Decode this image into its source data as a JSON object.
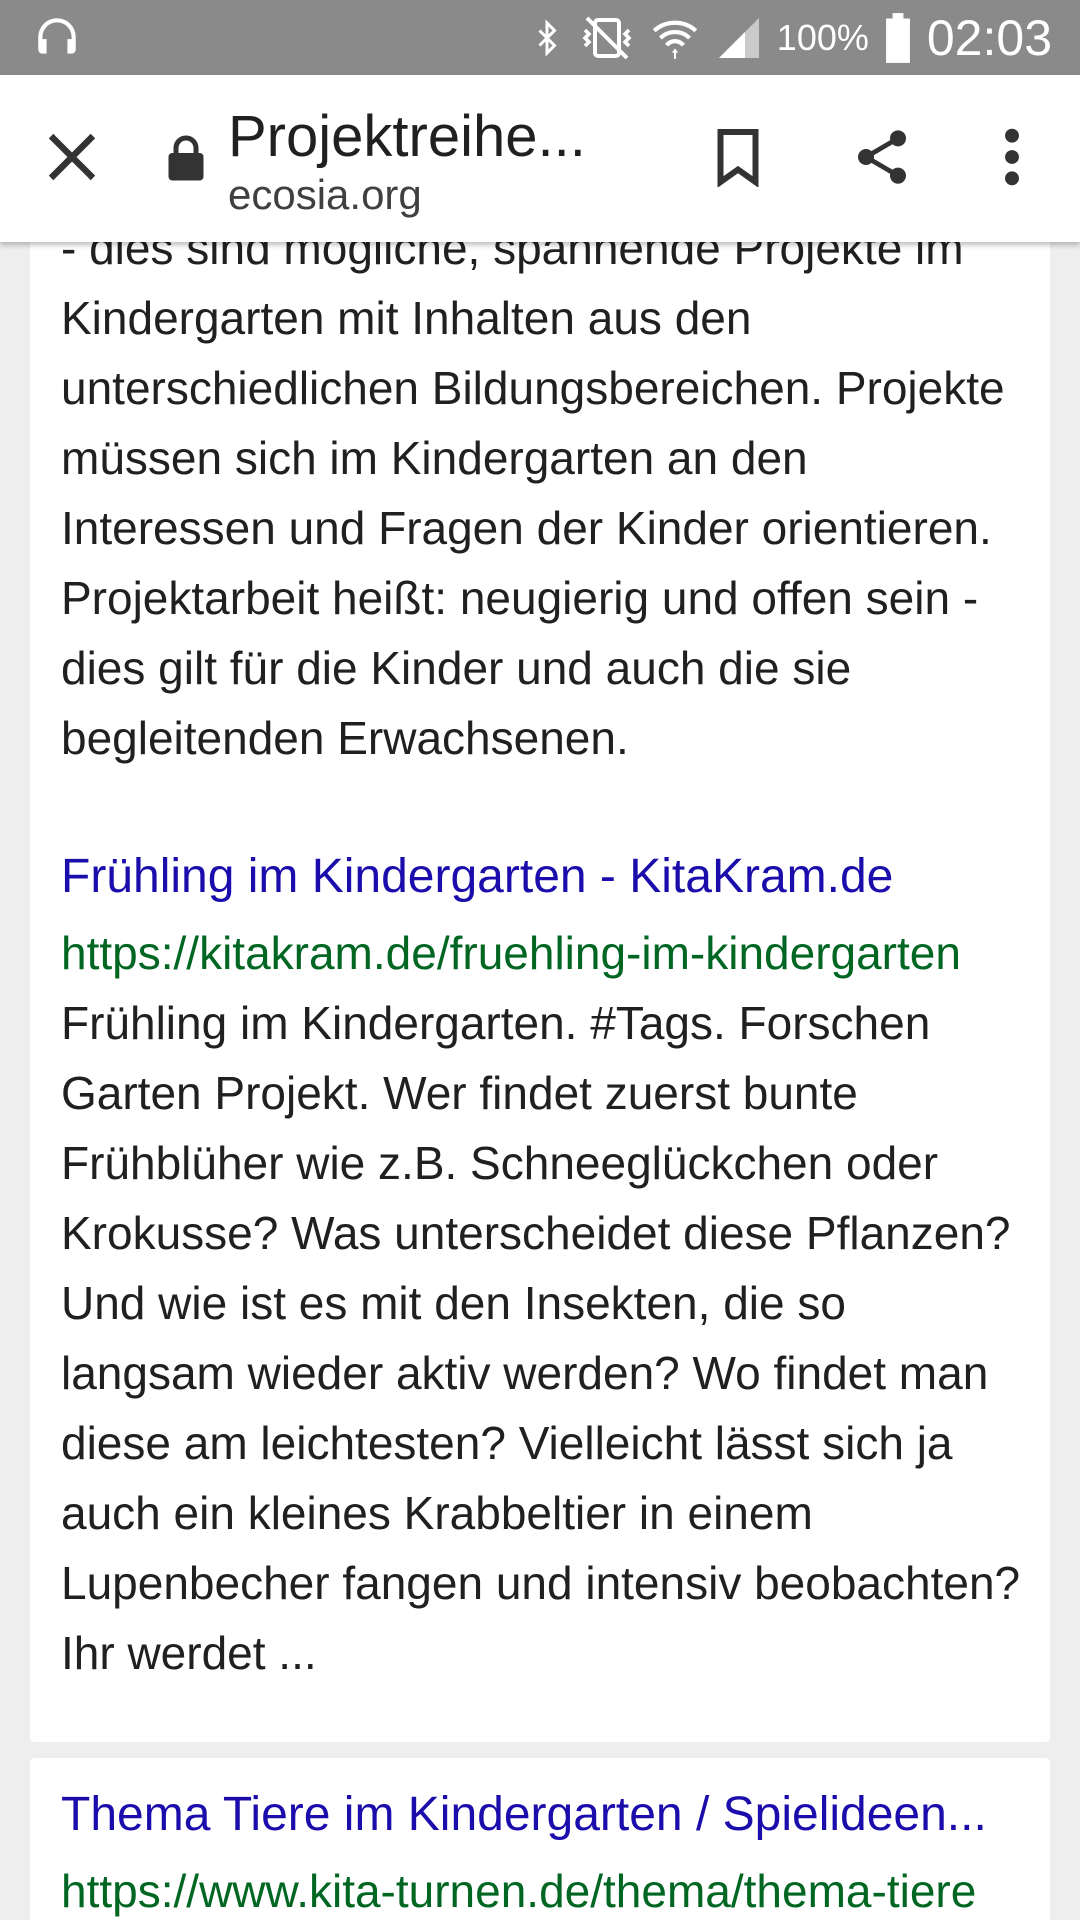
{
  "status_bar": {
    "battery_percent": "100%",
    "time": "02:03",
    "icons": [
      "headset-icon",
      "bluetooth-icon",
      "vibrate-mute-icon",
      "wifi-icon",
      "signal-icon",
      "battery-icon"
    ]
  },
  "toolbar": {
    "page_title": "Projektreihe...",
    "domain": "ecosia.org",
    "icons": [
      "close-icon",
      "lock-icon",
      "bookmark-icon",
      "share-icon",
      "more-vert-icon"
    ]
  },
  "results": [
    {
      "snippet": "- dies sind mögliche, spannende Projekte im Kindergarten mit Inhalten aus den unterschiedlichen Bildungsbereichen. Projekte müssen sich im Kindergarten an den Interessen und Fragen der Kinder orientieren. Projektarbeit heißt: neugierig und offen sein - dies gilt für die Kinder und auch die sie begleitenden Erwachsenen."
    },
    {
      "title": "Frühling im Kindergarten - KitaKram.de",
      "url": "https://kitakram.de/fruehling-im-kindergarten",
      "snippet": "Frühling im Kindergarten. #Tags. Forschen Garten Projekt. Wer findet zuerst bunte Frühblüher wie z.B. Schneeglückchen oder Krokusse? Was unterscheidet diese Pflanzen? Und wie ist es mit den Insekten, die so langsam wieder aktiv werden? Wo findet man diese am leichtesten? Vielleicht lässt sich ja auch ein kleines Krabbeltier in einem Lupenbecher fangen und intensiv beobachten? Ihr werdet ..."
    },
    {
      "title": "Thema Tiere im Kindergarten / Spielideen...",
      "url": "https://www.kita-turnen.de/thema/thema-tiere"
    }
  ],
  "colors": {
    "status_bar_bg": "#8a8a8a",
    "link_title": "#1a0dab",
    "link_url": "#006621",
    "page_bg": "#eeeeee"
  }
}
